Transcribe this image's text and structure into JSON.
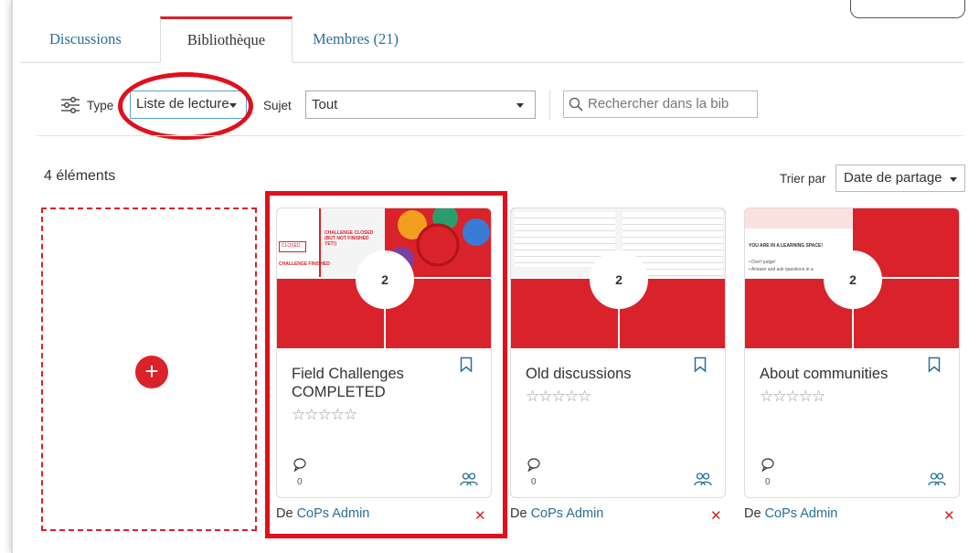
{
  "tabs": [
    {
      "label": "Discussions"
    },
    {
      "label": "Bibliothèque"
    },
    {
      "label": "Membres (21)"
    }
  ],
  "filters": {
    "type_label": "Type",
    "type_value": "Liste de lecture",
    "subject_label": "Sujet",
    "subject_value": "Tout",
    "search_placeholder": "Rechercher dans la bib"
  },
  "count_label": "4 éléments",
  "sort": {
    "label": "Trier par",
    "value": "Date de partage"
  },
  "add_button": "+",
  "cards": [
    {
      "title": "Field Challenges COMPLETED",
      "count": "2",
      "stars": "☆☆☆☆☆",
      "comments": "0",
      "author_prefix": "De",
      "author": "CoPs Admin",
      "remove": "✕"
    },
    {
      "title": "Old discussions",
      "count": "2",
      "stars": "☆☆☆☆☆",
      "comments": "0",
      "author_prefix": "De",
      "author": "CoPs Admin",
      "remove": "✕"
    },
    {
      "title": "About communities",
      "count": "2",
      "stars": "☆☆☆☆☆",
      "comments": "0",
      "author_prefix": "De",
      "author": "CoPs Admin",
      "remove": "✕"
    }
  ],
  "thumb_text": {
    "t1_closed_a": "CHALLENGE CLOSED (BUT NOT FINISHED YET!)",
    "t1_closed_b": "CLOSED",
    "t1_finished": "CHALLENGE FINISHED",
    "t3_space": "YOU ARE IN A LEARNING SPACE!",
    "t3_rule1": "• Don't judge!",
    "t3_rule2": "• Answer and ask questions in a"
  },
  "colors": {
    "accent": "#d9222a",
    "link": "#2a6f97",
    "highlight": "#e0101c"
  }
}
